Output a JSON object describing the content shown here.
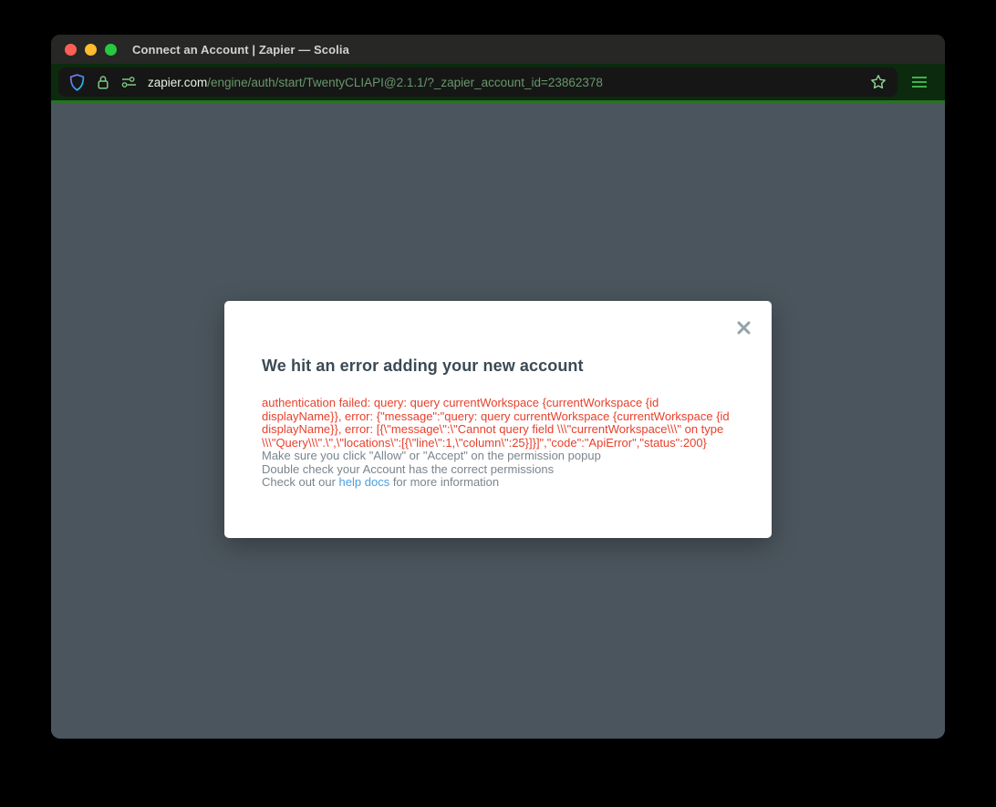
{
  "window": {
    "title": "Connect an Account | Zapier — Scolia"
  },
  "browser": {
    "url_host": "zapier.com",
    "url_path": "/engine/auth/start/TwentyCLIAPI@2.1.1/?_zapier_account_id=23862378"
  },
  "modal": {
    "title": "We hit an error adding your new account",
    "error_message": "authentication failed: query: query currentWorkspace {currentWorkspace {id displayName}}, error: {\"message\":\"query: query currentWorkspace {currentWorkspace {id displayName}}, error: [{\\\"message\\\":\\\"Cannot query field \\\\\\\"currentWorkspace\\\\\\\" on type \\\\\\\"Query\\\\\\\".\\\",\\\"locations\\\":[{\\\"line\\\":1,\\\"column\\\":25}]}]\",\"code\":\"ApiError\",\"status\":200}",
    "hints": [
      "Make sure you click \"Allow\" or \"Accept\" on the permission popup",
      "Double check your Account has the correct permissions"
    ],
    "help": {
      "prefix": "Check out our ",
      "link_label": "help docs",
      "suffix": " for more information"
    }
  },
  "icons": {
    "shield": "tracking-protection-shield",
    "lock": "connection-secure-lock",
    "permissions": "site-permissions-sliders",
    "bookmark": "star-outline",
    "menu": "hamburger",
    "close": "x-cross"
  },
  "colors": {
    "error_text": "#e8402c",
    "hint_text": "#7b858c",
    "link": "#4aa0e0",
    "heading": "#3b4a54",
    "toolbar_green": "#0b2a0e",
    "accent_green": "#267226",
    "url_host": "#e6f2e6",
    "url_path": "#67986a",
    "content_background": "#4b555d",
    "traffic_red": "#ff5f57",
    "traffic_yellow": "#febc2e",
    "traffic_green": "#28c840"
  }
}
